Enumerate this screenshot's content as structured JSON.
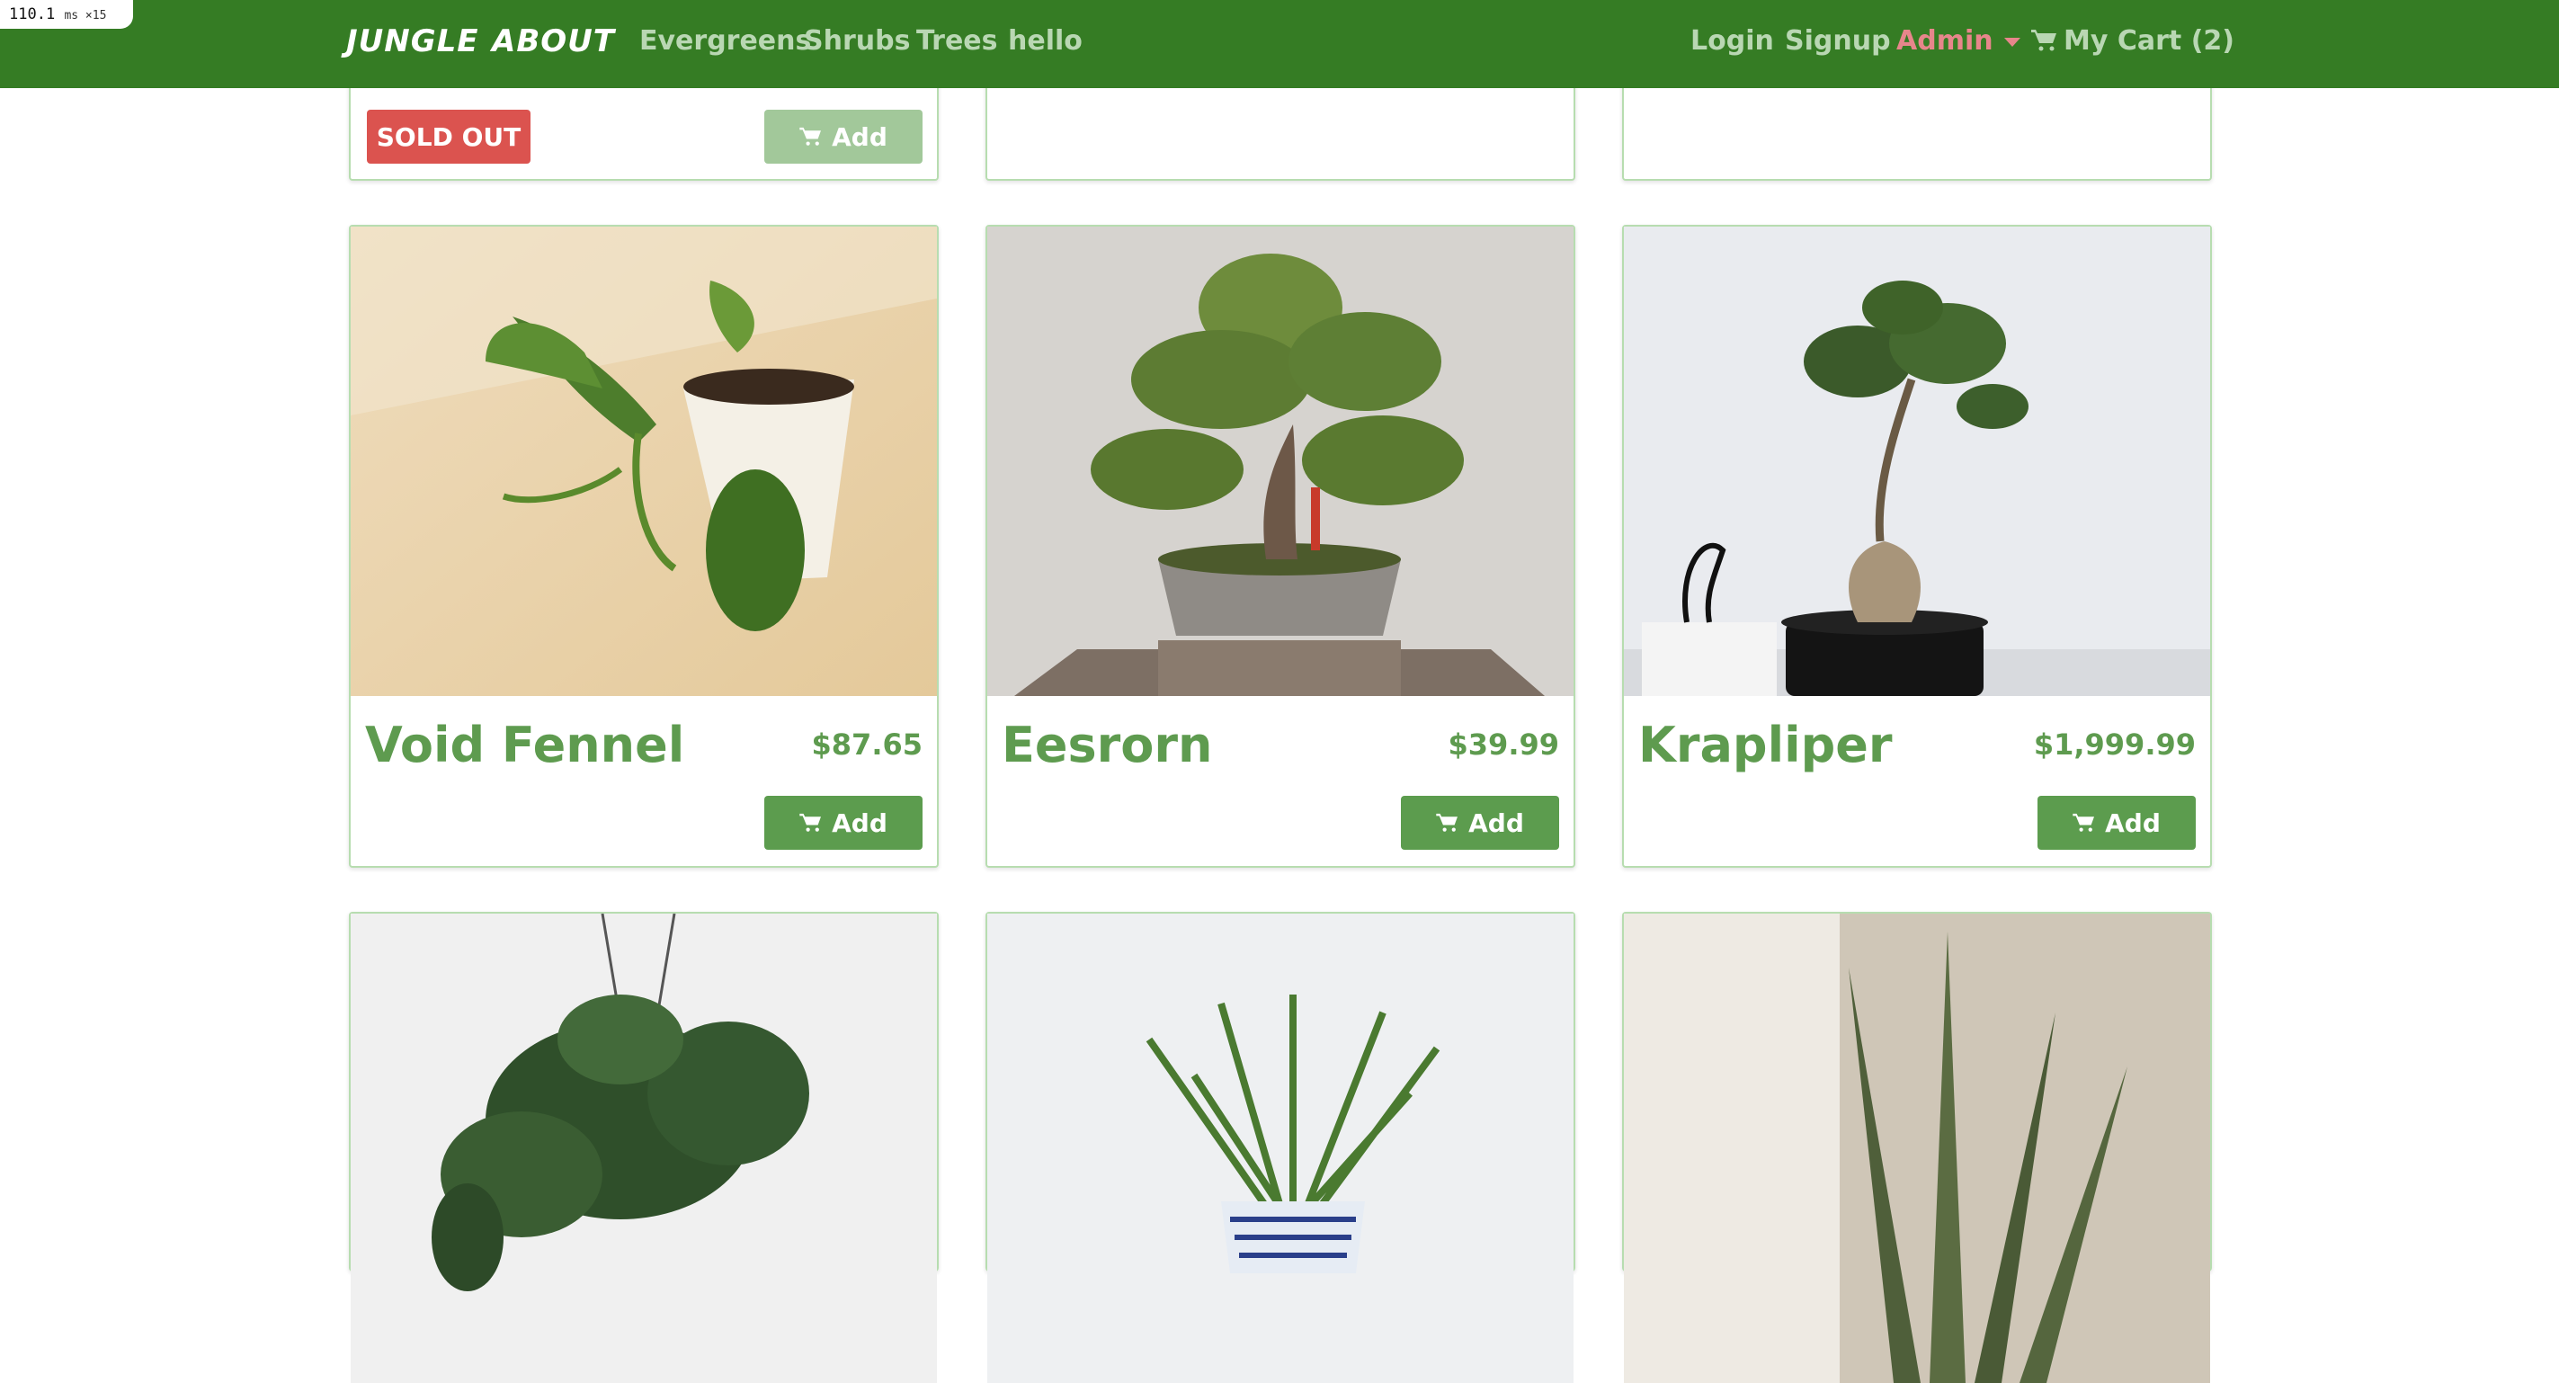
{
  "perf_badge": {
    "value": "110.1",
    "unit": "ms ×15"
  },
  "nav": {
    "brand_primary": "JUNGLE",
    "brand_secondary": "ABOUT",
    "categories": [
      "Evergreens",
      "Shrubs",
      "Trees",
      "hello"
    ],
    "login": "Login",
    "signup": "Signup",
    "admin": "Admin",
    "cart": "My Cart (2)"
  },
  "top_row": {
    "soldout_label": "SOLD OUT",
    "add_label": "Add"
  },
  "products": [
    {
      "name": "Void Fennel",
      "price": "$87.65",
      "add_label": "Add"
    },
    {
      "name": "Eesrorn",
      "price": "$39.99",
      "add_label": "Add"
    },
    {
      "name": "Krapliper",
      "price": "$1,999.99",
      "add_label": "Add"
    }
  ],
  "colors": {
    "navbar": "#357c24",
    "nav_link": "#b9d7b3",
    "admin_link": "#e7868b",
    "accent_green": "#5c9c4e",
    "sold_out_red": "#db534f"
  }
}
